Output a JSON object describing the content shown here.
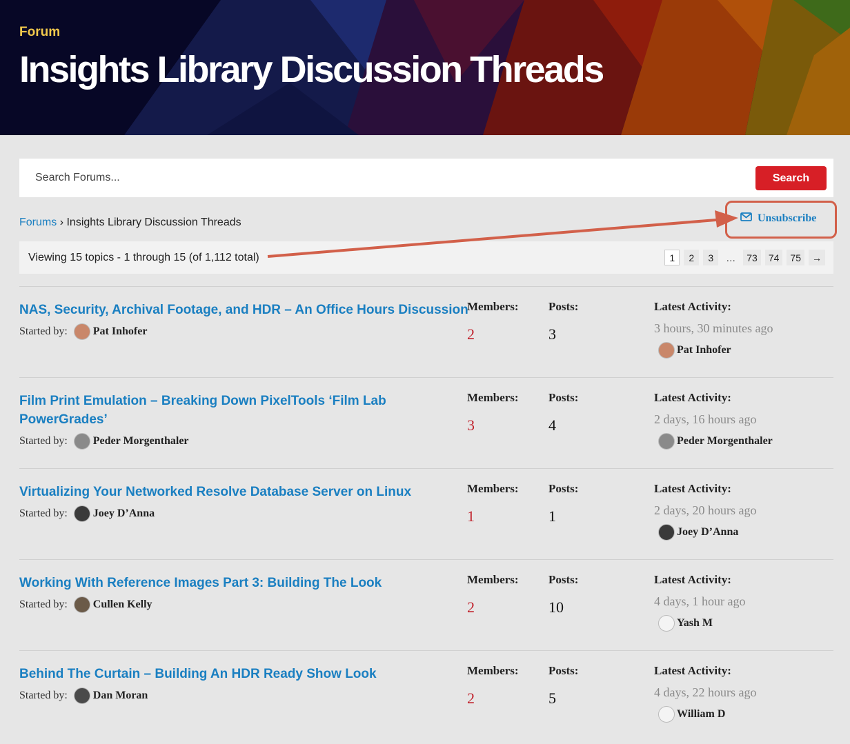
{
  "header": {
    "kicker": "Forum",
    "title": "Insights Library Discussion Threads"
  },
  "search": {
    "placeholder": "Search Forums...",
    "button_label": "Search"
  },
  "breadcrumb": {
    "root": "Forums",
    "separator": "›",
    "current": "Insights Library Discussion Threads"
  },
  "subscription": {
    "label": "Unsubscribe",
    "icon": "envelope-icon"
  },
  "listing": {
    "summary": "Viewing 15 topics - 1 through 15 (of 1,112 total)",
    "pagination": {
      "pages": [
        "1",
        "2",
        "3"
      ],
      "ellipsis": "…",
      "last_pages": [
        "73",
        "74",
        "75"
      ],
      "next": "→",
      "current": "1"
    }
  },
  "columns": {
    "members": "Members:",
    "posts": "Posts:",
    "latest": "Latest Activity:",
    "started_by": "Started by:"
  },
  "topics": [
    {
      "title": "NAS, Security, Archival Footage, and HDR – An Office Hours Discussion",
      "author": "Pat Inhofer",
      "members": "2",
      "posts": "3",
      "latest_time": "3 hours, 30 minutes ago",
      "latest_user": "Pat Inhofer"
    },
    {
      "title": "Film Print Emulation – Breaking Down PixelTools ‘Film Lab PowerGrades’",
      "author": "Peder Morgenthaler",
      "members": "3",
      "posts": "4",
      "latest_time": "2 days, 16 hours ago",
      "latest_user": "Peder Morgenthaler"
    },
    {
      "title": "Virtualizing Your Networked Resolve Database Server on Linux",
      "author": "Joey D’Anna",
      "members": "1",
      "posts": "1",
      "latest_time": "2 days, 20 hours ago",
      "latest_user": "Joey D’Anna"
    },
    {
      "title": "Working With Reference Images Part 3: Building The Look",
      "author": "Cullen Kelly",
      "members": "2",
      "posts": "10",
      "latest_time": "4 days, 1 hour ago",
      "latest_user": "Yash M"
    },
    {
      "title": "Behind The Curtain – Building An HDR Ready Show Look",
      "author": "Dan Moran",
      "members": "2",
      "posts": "5",
      "latest_time": "4 days, 22 hours ago",
      "latest_user": "William D"
    }
  ],
  "colors": {
    "link": "#1a7fc1",
    "search_button": "#d71f26",
    "members_value": "#c0202a",
    "annotation": "#d2604a",
    "kicker": "#f2c94c"
  }
}
